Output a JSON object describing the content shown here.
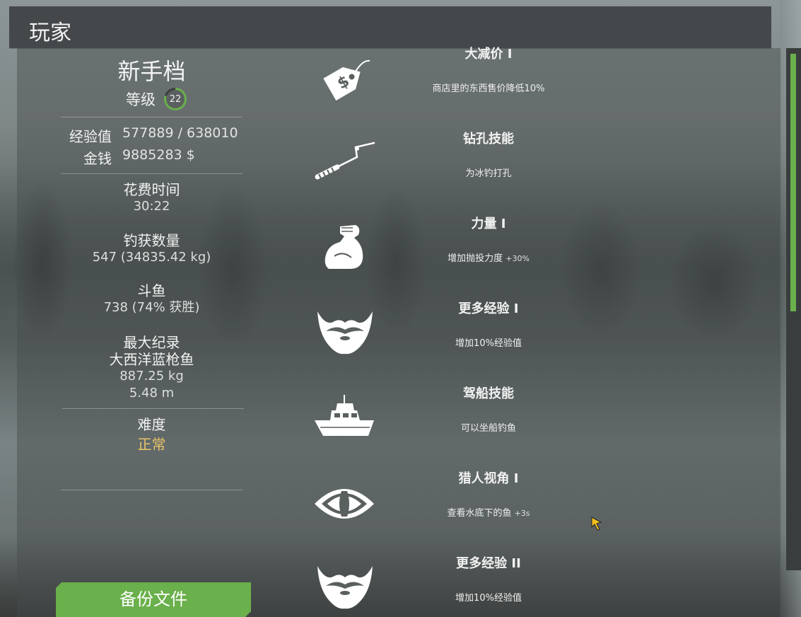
{
  "header": {
    "title": "玩家"
  },
  "player": {
    "name": "新手档",
    "level_label": "等级",
    "level": "22",
    "level_progress": 0.8,
    "exp_label": "经验值",
    "exp_value": "577889 / 638010",
    "money_label": "金钱",
    "money_value": "9885283 $",
    "time_label": "花费时间",
    "time_value": "30:22",
    "catch_label": "钓获数量",
    "catch_value": "547 (34835.42 kg)",
    "fight_label": "斗鱼",
    "fight_value": "738 (74% 获胜)",
    "record_label": "最大纪录",
    "record_fish": "大西洋蓝枪鱼",
    "record_weight": "887.25 kg",
    "record_length": "5.48 m",
    "difficulty_label": "难度",
    "difficulty_value": "正常"
  },
  "backup_button": "备份文件",
  "skills": [
    {
      "icon": "price-tag-icon",
      "title": "大减价 I",
      "desc": "商店里的东西售价降低10%",
      "bonus": ""
    },
    {
      "icon": "ice-drill-icon",
      "title": "钻孔技能",
      "desc": "为冰钓打孔",
      "bonus": ""
    },
    {
      "icon": "flexed-arm-icon",
      "title": "力量 I",
      "desc": "增加抛投力度",
      "bonus": "+30%"
    },
    {
      "icon": "beard-icon",
      "title": "更多经验 I",
      "desc": "增加10%经验值",
      "bonus": ""
    },
    {
      "icon": "boat-icon",
      "title": "驾船技能",
      "desc": "可以坐船钓鱼",
      "bonus": ""
    },
    {
      "icon": "eye-icon",
      "title": "猎人视角 I",
      "desc": "查看水底下的鱼",
      "bonus": "+3s"
    },
    {
      "icon": "beard-icon",
      "title": "更多经验 II",
      "desc": "增加10%经验值",
      "bonus": ""
    }
  ],
  "scroll": {
    "position": 0.0,
    "visible_fraction": 0.49
  },
  "colors": {
    "accent": "#6ab04c",
    "difficulty": "#e9c46a",
    "header": "#44484a"
  }
}
